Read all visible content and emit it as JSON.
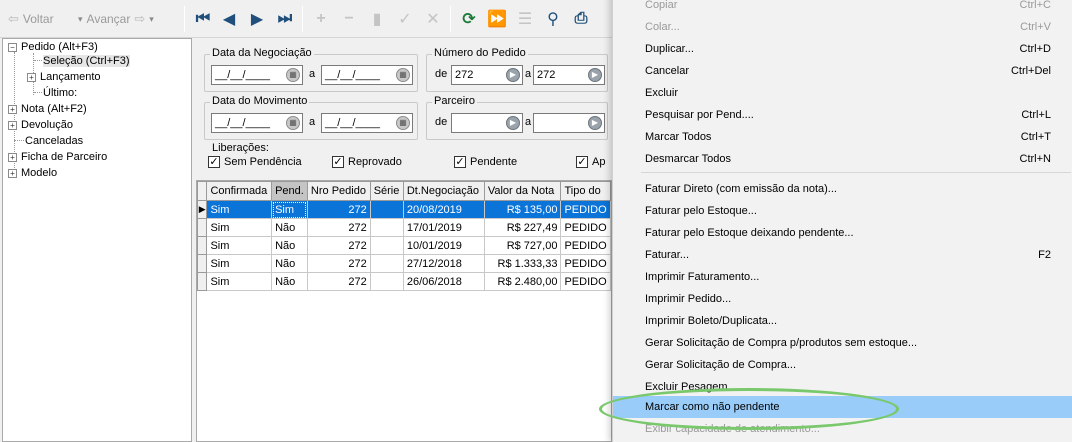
{
  "toolbar": {
    "back_label": "Voltar",
    "forward_label": "Avançar"
  },
  "tree": {
    "items": [
      {
        "label": "Pedido  (Alt+F3)",
        "expander": "−"
      },
      {
        "label": "Seleção (Ctrl+F3)"
      },
      {
        "label": "Lançamento",
        "expander": "+"
      },
      {
        "label": "Último:"
      },
      {
        "label": "Nota  (Alt+F2)",
        "expander": "+"
      },
      {
        "label": "Devolução",
        "expander": "+"
      },
      {
        "label": "Canceladas"
      },
      {
        "label": "Ficha de Parceiro",
        "expander": "+"
      },
      {
        "label": "Modelo",
        "expander": "+"
      }
    ]
  },
  "filters": {
    "negociacao": {
      "legend": "Data da Negociação",
      "from": "__/__/____",
      "sep": "a",
      "to": "__/__/____"
    },
    "numero": {
      "legend": "Número do Pedido",
      "de_label": "de",
      "from": "272",
      "sep": "a",
      "to": "272"
    },
    "movimento": {
      "legend": "Data do Movimento",
      "from": "__/__/____",
      "sep": "a",
      "to": "__/__/____"
    },
    "parceiro": {
      "legend": "Parceiro",
      "de_label": "de",
      "from": "",
      "sep": "a",
      "to": ""
    },
    "liberacoes": {
      "legend": "Liberações:",
      "options": [
        {
          "label": "Sem Pendência",
          "checked": "✓"
        },
        {
          "label": "Reprovado",
          "checked": "✓"
        },
        {
          "label": "Pendente",
          "checked": "✓"
        },
        {
          "label": "Ap",
          "checked": "✓"
        }
      ]
    }
  },
  "grid": {
    "columns": [
      "Confirmada",
      "Pend.",
      "Nro Pedido",
      "Série",
      "Dt.Negociação",
      "Valor da Nota",
      "Tipo do"
    ],
    "rows": [
      [
        "Sim",
        "Sim",
        "272",
        "",
        "20/08/2019",
        "R$ 135,00",
        "PEDIDO"
      ],
      [
        "Sim",
        "Não",
        "272",
        "",
        "17/01/2019",
        "R$ 227,49",
        "PEDIDO"
      ],
      [
        "Sim",
        "Não",
        "272",
        "",
        "10/01/2019",
        "R$ 727,00",
        "PEDIDO"
      ],
      [
        "Sim",
        "Não",
        "272",
        "",
        "27/12/2018",
        "R$ 1.333,33",
        "PEDIDO"
      ],
      [
        "Sim",
        "Não",
        "272",
        "",
        "26/06/2018",
        "R$ 2.480,00",
        "PEDIDO"
      ]
    ]
  },
  "menu": {
    "items": [
      {
        "label": "Copiar",
        "shortcut": "Ctrl+C",
        "disabled": true
      },
      {
        "label": "Colar...",
        "shortcut": "Ctrl+V",
        "disabled": true
      },
      {
        "label": "Duplicar...",
        "shortcut": "Ctrl+D"
      },
      {
        "label": "Cancelar",
        "shortcut": "Ctrl+Del"
      },
      {
        "label": "Excluir",
        "shortcut": ""
      },
      {
        "label": "Pesquisar por Pend....",
        "shortcut": "Ctrl+L"
      },
      {
        "label": "Marcar Todos",
        "shortcut": "Ctrl+T"
      },
      {
        "label": "Desmarcar Todos",
        "shortcut": "Ctrl+N"
      },
      {
        "label": "Faturar Direto (com emissão da nota)...",
        "shortcut": ""
      },
      {
        "label": "Faturar pelo Estoque...",
        "shortcut": ""
      },
      {
        "label": "Faturar pelo Estoque deixando pendente...",
        "shortcut": ""
      },
      {
        "label": "Faturar...",
        "shortcut": "F2"
      },
      {
        "label": "Imprimir Faturamento...",
        "shortcut": ""
      },
      {
        "label": "Imprimir Pedido...",
        "shortcut": ""
      },
      {
        "label": "Imprimir Boleto/Duplicata...",
        "shortcut": ""
      },
      {
        "label": "Gerar Solicitação de Compra p/produtos sem estoque...",
        "shortcut": ""
      },
      {
        "label": "Gerar Solicitação de Compra...",
        "shortcut": ""
      },
      {
        "label": "Excluir Pesagem...",
        "shortcut": ""
      },
      {
        "label": "Marcar como não pendente",
        "shortcut": "",
        "highlighted": true
      },
      {
        "label": "Exibir capacidade de atendimento...",
        "shortcut": "",
        "disabled": true
      }
    ]
  },
  "colors": {
    "selection": "#0a74d8",
    "menu_highlight": "#99ccf8",
    "annotation_ellipse": "#79c86b"
  }
}
